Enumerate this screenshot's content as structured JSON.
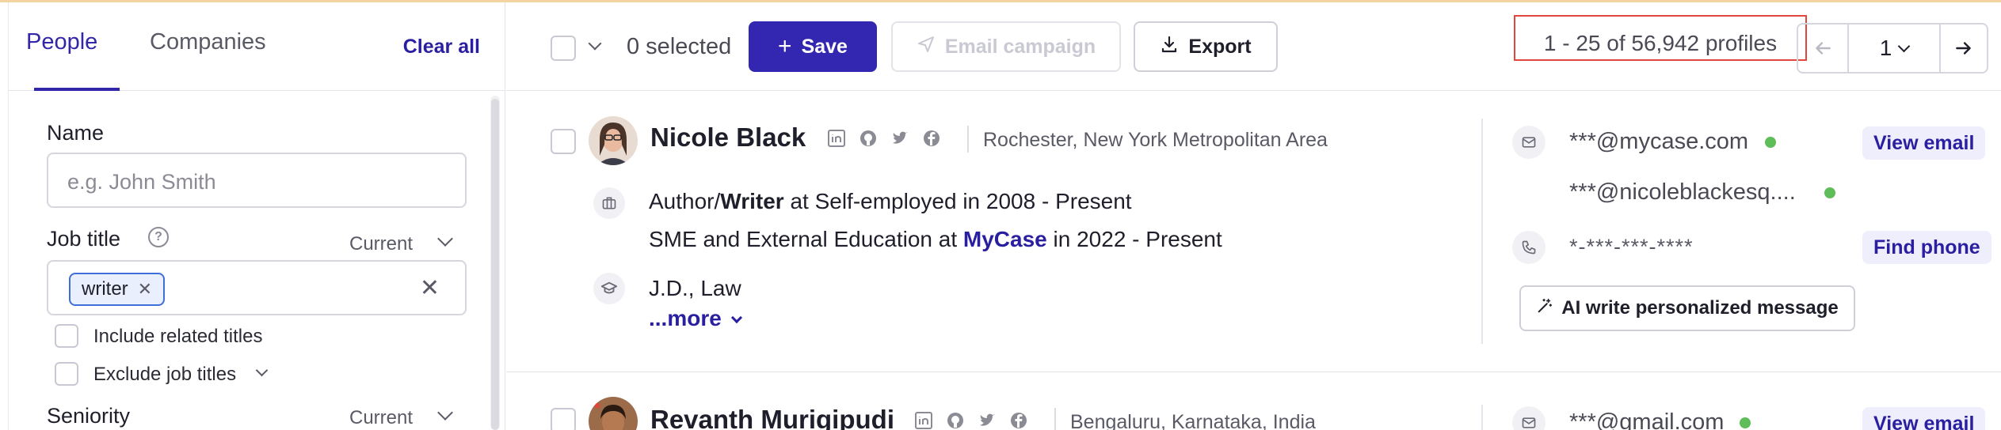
{
  "sidebar": {
    "tabs": [
      {
        "label": "People",
        "active": true
      },
      {
        "label": "Companies",
        "active": false
      }
    ],
    "clear_all": "Clear all",
    "name": {
      "label": "Name",
      "placeholder": "e.g. John Smith"
    },
    "job_title": {
      "label": "Job title",
      "filter": "Current",
      "chip": "writer",
      "include_related": "Include related titles",
      "exclude": "Exclude job titles"
    },
    "seniority": {
      "label": "Seniority",
      "filter": "Current"
    }
  },
  "toolbar": {
    "selected": "0 selected",
    "save": "Save",
    "email_campaign": "Email campaign",
    "export": "Export",
    "profiles_count": "1 - 25 of 56,942 profiles",
    "page": "1"
  },
  "rows": [
    {
      "name": "Nicole Black",
      "location": "Rochester, New York Metropolitan Area",
      "job1_role": "Author/",
      "job1_role_bold": "Writer",
      "job1_rest": " at Self-employed in 2008 - Present",
      "job2_pre": "SME and External Education at ",
      "job2_company": "MyCase",
      "job2_rest": " in 2022 - Present",
      "education": "J.D., Law",
      "more": "...more",
      "email1": "***@mycase.com",
      "email2": "***@nicoleblackesq....",
      "phone": "*-***-***-****",
      "view_email": "View email",
      "find_phone": "Find phone",
      "ai_message": "AI write personalized message"
    },
    {
      "name": "Revanth Murigipudi",
      "location": "Bengaluru, Karnataka, India",
      "email1": "***@gmail.com",
      "view_email": "View email"
    }
  ],
  "colors": {
    "accent": "#3326b0",
    "link": "#2a1fa0",
    "status_green": "#5fbd5a",
    "highlight_box": "#e0463b"
  }
}
